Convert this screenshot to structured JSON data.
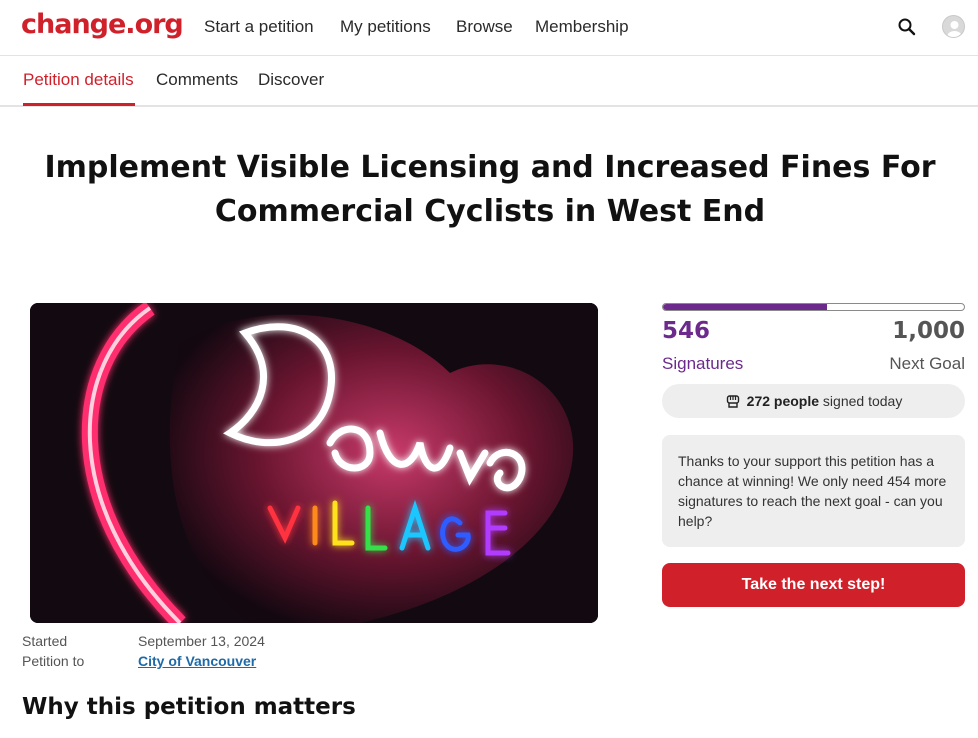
{
  "brand": {
    "logo_text": "change.org",
    "accent": "#d0212b",
    "purple": "#6b2a8c"
  },
  "header": {
    "nav": [
      "Start a petition",
      "My petitions",
      "Browse",
      "Membership"
    ],
    "search_icon": "search-icon",
    "avatar_icon": "user-avatar-icon"
  },
  "tabs": [
    {
      "label": "Petition details",
      "active": true
    },
    {
      "label": "Comments",
      "active": false
    },
    {
      "label": "Discover",
      "active": false
    }
  ],
  "petition": {
    "title_line1": "Implement Visible Licensing and Increased Fines For",
    "title_line2": "Commercial Cyclists in West End",
    "started_label": "Started",
    "started_value": "September 13, 2024",
    "petition_to_label": "Petition to",
    "petition_to_value": "City of Vancouver",
    "why_heading": "Why this petition matters"
  },
  "signatures": {
    "count": "546",
    "count_label": "Signatures",
    "goal": "1,000",
    "goal_label": "Next Goal",
    "progress_fraction": 0.546,
    "today_count": "272 people",
    "today_suffix": "signed today",
    "today_icon": "raised-fist-icon"
  },
  "notice": {
    "text": "Thanks to your support this petition has a chance at winning! We only need 454 more signatures to reach the next goal - can you help?"
  },
  "cta": {
    "label": "Take the next step!"
  }
}
